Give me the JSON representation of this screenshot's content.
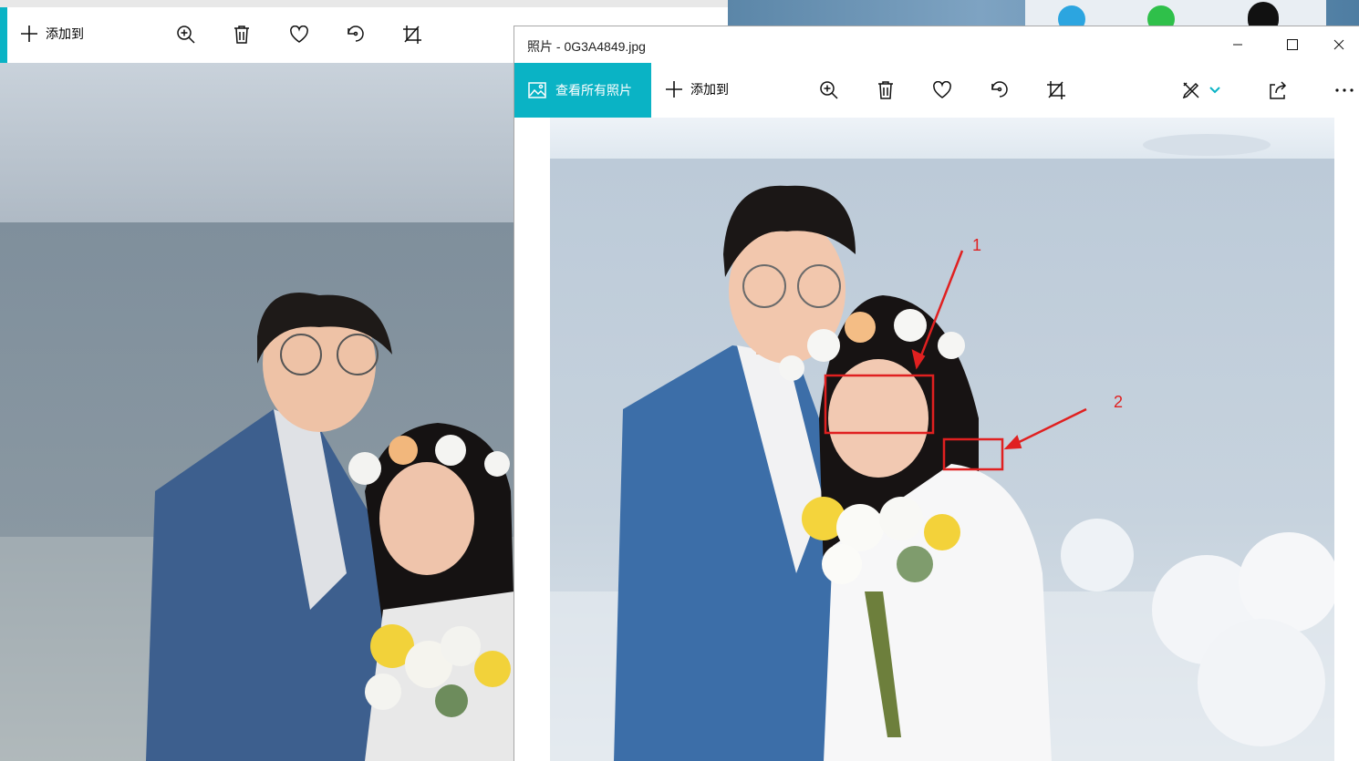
{
  "back_window": {
    "toolbar": {
      "add_to_label": "添加到",
      "icons": [
        "zoom-in-icon",
        "trash-icon",
        "heart-icon",
        "rotate-icon",
        "crop-icon"
      ]
    }
  },
  "front_window": {
    "title": "照片 - 0G3A4849.jpg",
    "toolbar": {
      "view_all_label": "查看所有照片",
      "add_to_label": "添加到",
      "icons": [
        "zoom-in-icon",
        "trash-icon",
        "heart-icon",
        "rotate-icon",
        "crop-icon",
        "edit-draw-icon",
        "chevron-down-icon",
        "share-icon",
        "more-icon"
      ]
    },
    "annotations": [
      {
        "label": "1"
      },
      {
        "label": "2"
      }
    ]
  },
  "colors": {
    "accent": "#0ab3c5",
    "annotation": "#e02020",
    "suit": "#3c6ea8"
  }
}
